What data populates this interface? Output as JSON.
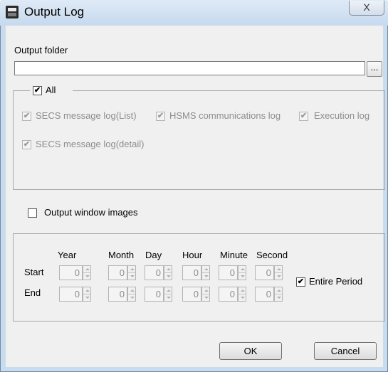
{
  "window": {
    "title": "Output Log",
    "close_symbol": "X"
  },
  "output_folder": {
    "label": "Output folder",
    "value": "",
    "browse_label": "..."
  },
  "log_group": {
    "all_label": "All",
    "all_checked": true,
    "items": [
      {
        "label": "SECS message log(List)",
        "checked": true
      },
      {
        "label": "HSMS communications log",
        "checked": true
      },
      {
        "label": "Execution log",
        "checked": true
      },
      {
        "label": "SECS message log(detail)",
        "checked": true
      }
    ]
  },
  "window_images": {
    "label": "Output window images",
    "checked": false
  },
  "period": {
    "headers": [
      "Year",
      "Month",
      "Day",
      "Hour",
      "Minute",
      "Second"
    ],
    "start_label": "Start",
    "end_label": "End",
    "start_values": [
      "0",
      "0",
      "0",
      "0",
      "0",
      "0"
    ],
    "end_values": [
      "0",
      "0",
      "0",
      "0",
      "0",
      "0"
    ],
    "entire_period_label": "Entire Period",
    "entire_period_checked": true
  },
  "buttons": {
    "ok": "OK",
    "cancel": "Cancel"
  }
}
